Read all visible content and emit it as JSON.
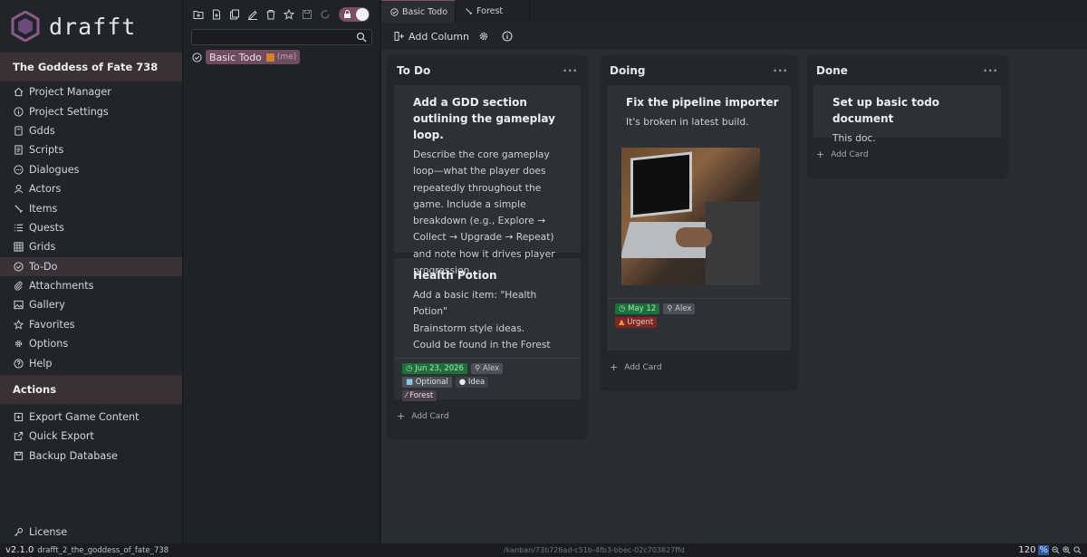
{
  "app": {
    "logo_text": "drafft",
    "project_name": "The Goddess of Fate 738",
    "accent_color": "#7a4f66"
  },
  "sidebar": {
    "items": [
      {
        "label": "Project Manager",
        "icon": "home-icon"
      },
      {
        "label": "Project Settings",
        "icon": "info-icon"
      },
      {
        "label": "Gdds",
        "icon": "book-icon"
      },
      {
        "label": "Scripts",
        "icon": "script-icon"
      },
      {
        "label": "Dialogues",
        "icon": "chat-icon"
      },
      {
        "label": "Actors",
        "icon": "person-icon"
      },
      {
        "label": "Items",
        "icon": "sword-icon"
      },
      {
        "label": "Quests",
        "icon": "list-icon"
      },
      {
        "label": "Grids",
        "icon": "grid-icon"
      },
      {
        "label": "To-Do",
        "icon": "check-circle-icon",
        "active": true
      },
      {
        "label": "Attachments",
        "icon": "paperclip-icon"
      },
      {
        "label": "Gallery",
        "icon": "image-icon"
      },
      {
        "label": "Favorites",
        "icon": "star-icon"
      },
      {
        "label": "Options",
        "icon": "gear-icon"
      },
      {
        "label": "Help",
        "icon": "help-icon"
      }
    ],
    "actions_title": "Actions",
    "actions": [
      {
        "label": "Export Game Content",
        "icon": "export-icon"
      },
      {
        "label": "Quick Export",
        "icon": "quick-export-icon"
      },
      {
        "label": "Backup Database",
        "icon": "database-icon"
      }
    ],
    "license_label": "License"
  },
  "filepanel": {
    "search_placeholder": "",
    "tree": [
      {
        "label": "Basic Todo",
        "owner": "(me)"
      }
    ]
  },
  "tabs": [
    {
      "label": "Basic Todo",
      "icon": "check-circle-icon",
      "active": true
    },
    {
      "label": "Forest",
      "icon": "sword-icon",
      "active": false
    }
  ],
  "actionbar": {
    "add_column_label": "Add Column"
  },
  "board": {
    "add_card_label": "Add Card",
    "columns": [
      {
        "title": "To Do",
        "cards": [
          {
            "title": "Add a GDD section outlining the gameplay loop.",
            "description": "Describe the core gameplay loop—what the player does repeatedly throughout the game. Include a simple breakdown (e.g., Explore → Collect → Upgrade → Repeat) and note how it drives player progression."
          },
          {
            "title": "Health Potion",
            "description_lines": [
              "Add a basic item: \"Health Potion\"",
              "Brainstorm style ideas.",
              "Could be found in the Forest"
            ],
            "date": "Jun 23, 2026",
            "assignee": "Alex",
            "tags": [
              "Optional",
              "Idea"
            ],
            "link": "Forest"
          }
        ]
      },
      {
        "title": "Doing",
        "cards": [
          {
            "title": "Fix the pipeline importer",
            "description": "It's broken in latest build.",
            "date": "May 12",
            "assignee": "Alex",
            "tags": [
              "Urgent"
            ]
          }
        ]
      },
      {
        "title": "Done",
        "cards": [
          {
            "title": "Set up basic todo document",
            "description": "This doc."
          }
        ]
      }
    ]
  },
  "statusbar": {
    "version": "v2.1.0",
    "project_file": "drafft_2_the_goddess_of_fate_738",
    "path": "/kanban/73b726ad-c51b-4fb3-bbec-02c703827ffd",
    "zoom_value": "120",
    "zoom_unit": "%"
  }
}
